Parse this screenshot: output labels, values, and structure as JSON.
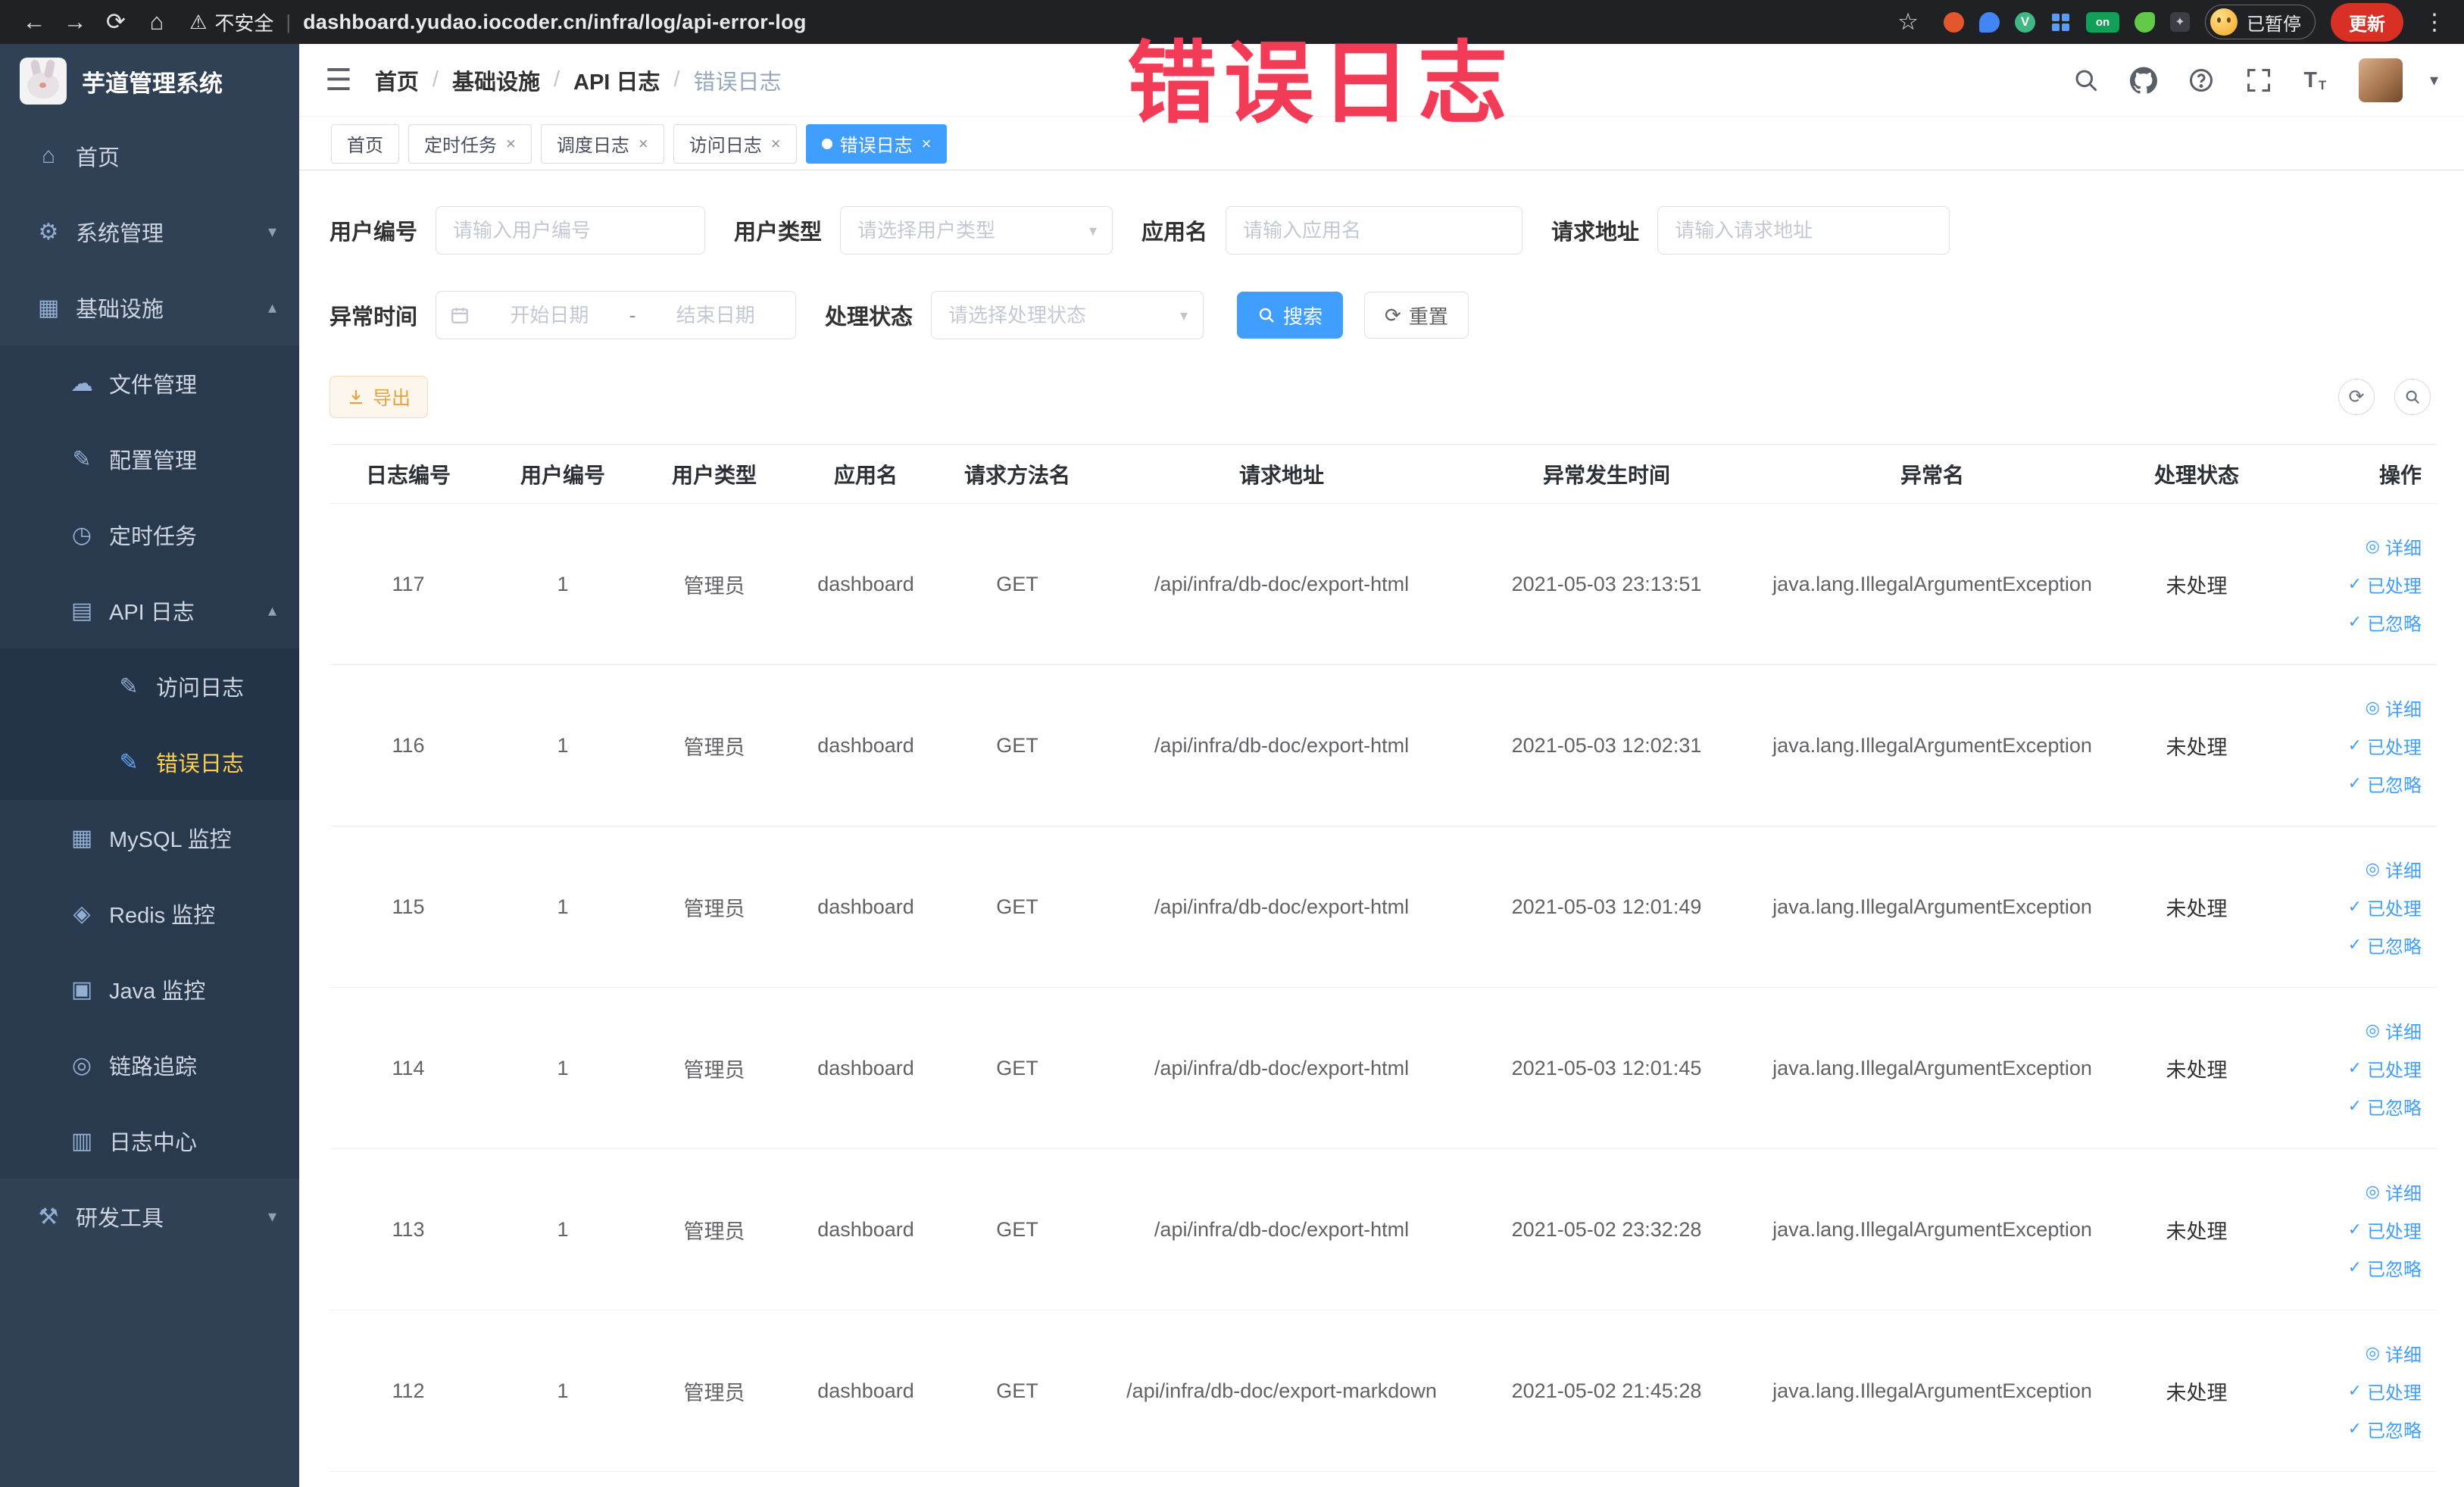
{
  "colors": {
    "accent": "#409eff",
    "warning": "#e6a23c",
    "annotation": "#f23b57",
    "sidebar_bg": "#304156",
    "active_menu_text": "#ffd04b",
    "update_button": "#d93025"
  },
  "browser": {
    "security_label": "不安全",
    "url": "dashboard.yudao.iocoder.cn/infra/log/api-error-log",
    "ext_on_label": "on",
    "ext_v_label": "V",
    "paused_label": "已暂停",
    "update_label": "更新"
  },
  "annotation": {
    "text": "错误日志"
  },
  "icons": {
    "back": "←",
    "forward": "→",
    "reload": "⟳",
    "home": "⌂",
    "warning": "⚠",
    "star": "☆",
    "kebab": "⋮",
    "pin": "✦",
    "menu_home": "⌂",
    "menu_system": "⚙",
    "menu_infra": "▦",
    "menu_file": "☁",
    "menu_config": "✎",
    "menu_job": "◷",
    "menu_apilog": "▤",
    "menu_accesslog": "✎",
    "menu_errorlog": "✎",
    "menu_mysql": "▦",
    "menu_redis": "◈",
    "menu_java": "▣",
    "menu_trace": "◎",
    "menu_logcenter": "▥",
    "menu_devtools": "⚒",
    "chevron_down": "▾",
    "chevron_up": "▴",
    "select_caret": "▾",
    "close": "×",
    "refresh": "⟳",
    "eye": "◎",
    "check": "✓"
  },
  "sidebar": {
    "title": "芋道管理系统",
    "items": [
      {
        "label": "首页"
      },
      {
        "label": "系统管理"
      },
      {
        "label": "基础设施"
      },
      {
        "label": "文件管理"
      },
      {
        "label": "配置管理"
      },
      {
        "label": "定时任务"
      },
      {
        "label": "API 日志"
      },
      {
        "label": "访问日志"
      },
      {
        "label": "错误日志"
      },
      {
        "label": "MySQL 监控"
      },
      {
        "label": "Redis 监控"
      },
      {
        "label": "Java 监控"
      },
      {
        "label": "链路追踪"
      },
      {
        "label": "日志中心"
      },
      {
        "label": "研发工具"
      }
    ]
  },
  "header": {
    "breadcrumb": [
      "首页",
      "基础设施",
      "API 日志",
      "错误日志"
    ],
    "separator": "/"
  },
  "tabs": [
    {
      "label": "首页"
    },
    {
      "label": "定时任务"
    },
    {
      "label": "调度日志"
    },
    {
      "label": "访问日志"
    },
    {
      "label": "错误日志"
    }
  ],
  "filters": {
    "user_id_label": "用户编号",
    "user_id_placeholder": "请输入用户编号",
    "user_type_label": "用户类型",
    "user_type_placeholder": "请选择用户类型",
    "app_name_label": "应用名",
    "app_name_placeholder": "请输入应用名",
    "request_url_label": "请求地址",
    "request_url_placeholder": "请输入请求地址",
    "exception_time_label": "异常时间",
    "start_date_placeholder": "开始日期",
    "end_date_placeholder": "结束日期",
    "date_separator": "-",
    "process_status_label": "处理状态",
    "process_status_placeholder": "请选择处理状态",
    "search_label": "搜索",
    "reset_label": "重置"
  },
  "toolbar": {
    "export_label": "导出"
  },
  "table": {
    "columns": [
      "日志编号",
      "用户编号",
      "用户类型",
      "应用名",
      "请求方法名",
      "请求地址",
      "异常发生时间",
      "异常名",
      "处理状态",
      "操作"
    ],
    "actions": {
      "detail": "详细",
      "processed": "已处理",
      "ignored": "已忽略"
    },
    "rows": [
      {
        "log_id": "117",
        "user_id": "1",
        "user_type": "管理员",
        "app_name": "dashboard",
        "method": "GET",
        "url": "/api/infra/db-doc/export-html",
        "time": "2021-05-03 23:13:51",
        "exception": "java.lang.IllegalArgumentException",
        "status": "未处理"
      },
      {
        "log_id": "116",
        "user_id": "1",
        "user_type": "管理员",
        "app_name": "dashboard",
        "method": "GET",
        "url": "/api/infra/db-doc/export-html",
        "time": "2021-05-03 12:02:31",
        "exception": "java.lang.IllegalArgumentException",
        "status": "未处理"
      },
      {
        "log_id": "115",
        "user_id": "1",
        "user_type": "管理员",
        "app_name": "dashboard",
        "method": "GET",
        "url": "/api/infra/db-doc/export-html",
        "time": "2021-05-03 12:01:49",
        "exception": "java.lang.IllegalArgumentException",
        "status": "未处理"
      },
      {
        "log_id": "114",
        "user_id": "1",
        "user_type": "管理员",
        "app_name": "dashboard",
        "method": "GET",
        "url": "/api/infra/db-doc/export-html",
        "time": "2021-05-03 12:01:45",
        "exception": "java.lang.IllegalArgumentException",
        "status": "未处理"
      },
      {
        "log_id": "113",
        "user_id": "1",
        "user_type": "管理员",
        "app_name": "dashboard",
        "method": "GET",
        "url": "/api/infra/db-doc/export-html",
        "time": "2021-05-02 23:32:28",
        "exception": "java.lang.IllegalArgumentException",
        "status": "未处理"
      },
      {
        "log_id": "112",
        "user_id": "1",
        "user_type": "管理员",
        "app_name": "dashboard",
        "method": "GET",
        "url": "/api/infra/db-doc/export-markdown",
        "time": "2021-05-02 21:45:28",
        "exception": "java.lang.IllegalArgumentException",
        "status": "未处理"
      }
    ]
  }
}
